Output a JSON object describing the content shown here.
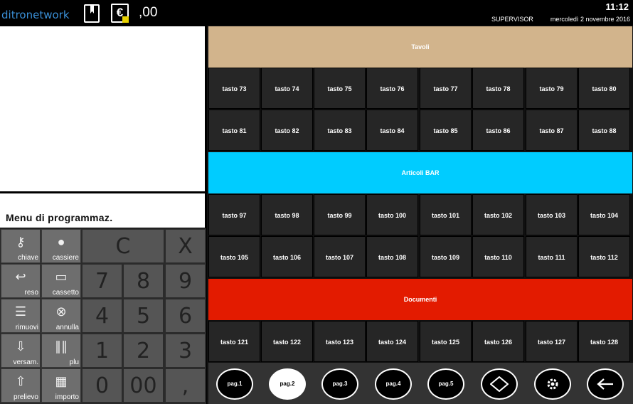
{
  "header": {
    "logo": "ditronetwork",
    "total": ",00",
    "time": "11:12",
    "user": "SUPERVISOR",
    "date": "mercoledì 2 novembre 2016"
  },
  "left": {
    "menu_label": "Menu di programmaz.",
    "function_keys": [
      {
        "label": "chiave",
        "icon": "key-icon"
      },
      {
        "label": "cassiere",
        "icon": "user-icon"
      },
      {
        "label": "reso",
        "icon": "return-arrow-icon"
      },
      {
        "label": "cassetto",
        "icon": "drawer-icon"
      },
      {
        "label": "rimuovi",
        "icon": "remove-list-icon"
      },
      {
        "label": "annulla",
        "icon": "cancel-icon"
      },
      {
        "label": "versam.",
        "icon": "deposit-icon"
      },
      {
        "label": "plu",
        "icon": "barcode-icon"
      },
      {
        "label": "prelievo",
        "icon": "withdraw-icon"
      },
      {
        "label": "importo",
        "icon": "amount-icon"
      }
    ],
    "keys": {
      "clear": "C",
      "cancel": "X",
      "k7": "7",
      "k8": "8",
      "k9": "9",
      "k4": "4",
      "k5": "5",
      "k6": "6",
      "k1": "1",
      "k2": "2",
      "k3": "3",
      "k0": "0",
      "k00": "00",
      "comma": ","
    }
  },
  "categories": [
    {
      "label": "Tavoli",
      "color": "#d2b48c"
    },
    {
      "label": "Articoli BAR",
      "color": "#00ccff"
    },
    {
      "label": "Documenti",
      "color": "#e31b00"
    }
  ],
  "rows": [
    [
      "tasto 73",
      "tasto 74",
      "tasto 75",
      "tasto 76",
      "tasto 77",
      "tasto 78",
      "tasto 79",
      "tasto 80"
    ],
    [
      "tasto 81",
      "tasto 82",
      "tasto 83",
      "tasto 84",
      "tasto 85",
      "tasto 86",
      "tasto 87",
      "tasto 88"
    ],
    [
      "tasto 97",
      "tasto 98",
      "tasto 99",
      "tasto 100",
      "tasto 101",
      "tasto 102",
      "tasto 103",
      "tasto 104"
    ],
    [
      "tasto 105",
      "tasto 106",
      "tasto 107",
      "tasto 108",
      "tasto 109",
      "tasto 110",
      "tasto 111",
      "tasto 112"
    ],
    [
      "tasto 121",
      "tasto 122",
      "tasto 123",
      "tasto 124",
      "tasto 125",
      "tasto 126",
      "tasto 127",
      "tasto 128"
    ]
  ],
  "pages": [
    "pag.1",
    "pag.2",
    "pag.3",
    "pag.4",
    "pag.5"
  ],
  "active_page": "pag.2",
  "page_icons": [
    "navigate-icon",
    "settings-gear-icon",
    "back-arrow-icon"
  ]
}
